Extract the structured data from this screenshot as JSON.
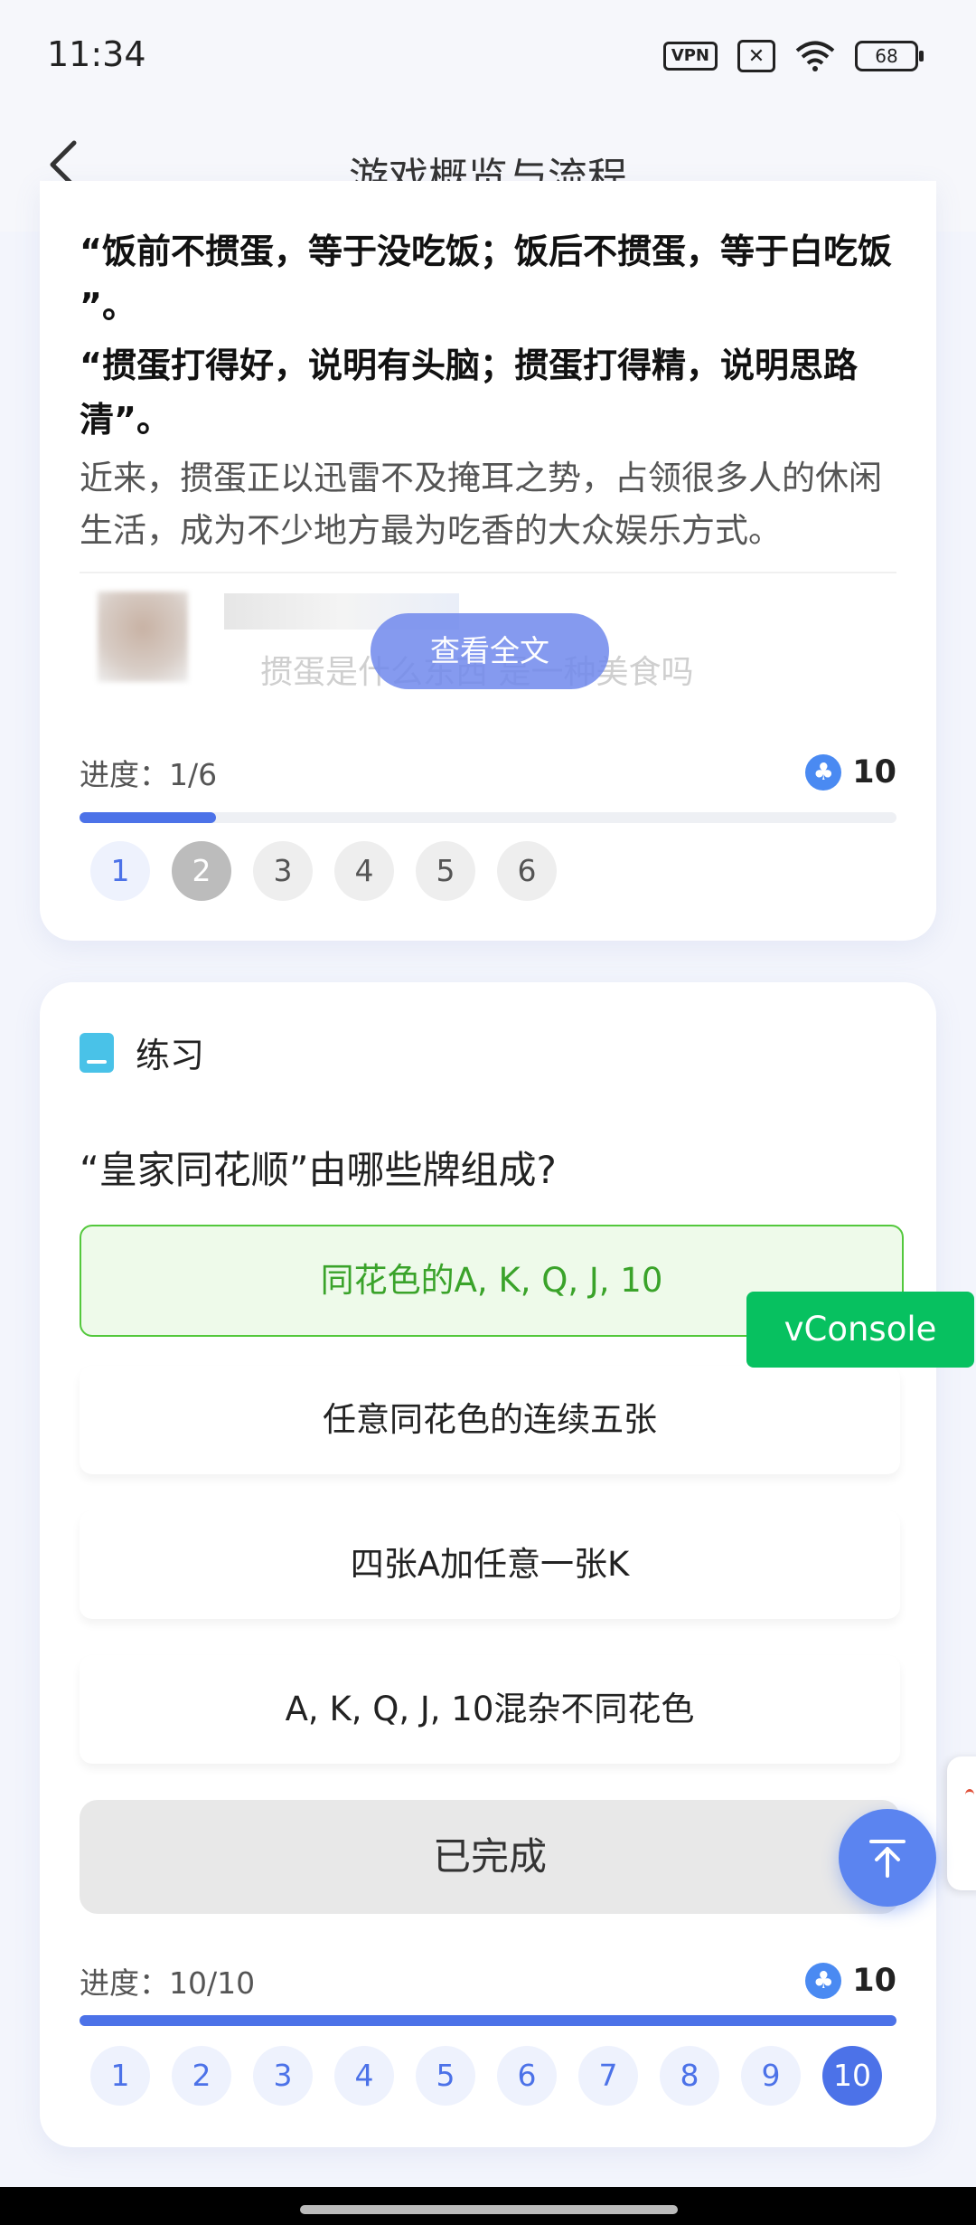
{
  "status_bar": {
    "time": "11:34",
    "vpn": "VPN",
    "battery": "68"
  },
  "header": {
    "title": "游戏概览与流程",
    "back_icon": "chevron-left-icon"
  },
  "article": {
    "quote_1": "“饭前不掼蛋，等于没吃饭；饭后不掼蛋，等于白吃饭 ”。",
    "quote_2": "“掼蛋打得好，说明有头脑；掼蛋打得精，说明思路清”。",
    "paragraph": "近来，掼蛋正以迅雷不及掩耳之势，占领很多人的休闲生活，成为不少地方最为吃香的大众娱乐方式。",
    "blurred_preview": "掼蛋是什么东西 是一种美食吗",
    "read_more": "查看全文"
  },
  "lesson_progress": {
    "label": "进度：1/6",
    "coins": "10",
    "fraction": 0.1667,
    "steps": [
      "1",
      "2",
      "3",
      "4",
      "5",
      "6"
    ],
    "current_step": 2
  },
  "practice": {
    "section_title": "练习",
    "question": "“皇家同花顺”由哪些牌组成?",
    "options": [
      "同花色的A, K, Q, J, 10",
      "任意同花色的连续五张",
      "四张A加任意一张K",
      "A, K, Q, J, 10混杂不同花色"
    ],
    "correct_option": 0,
    "done_button": "已完成"
  },
  "practice_progress": {
    "label": "进度：10/10",
    "coins": "10",
    "fraction": 1.0,
    "steps": [
      "1",
      "2",
      "3",
      "4",
      "5",
      "6",
      "7",
      "8",
      "9",
      "10"
    ],
    "current_step": 10
  },
  "overlay": {
    "vconsole": "vConsole"
  },
  "colors": {
    "accent": "#4c72e8",
    "correct_green": "#53c83c",
    "vconsole_green": "#07c160"
  }
}
